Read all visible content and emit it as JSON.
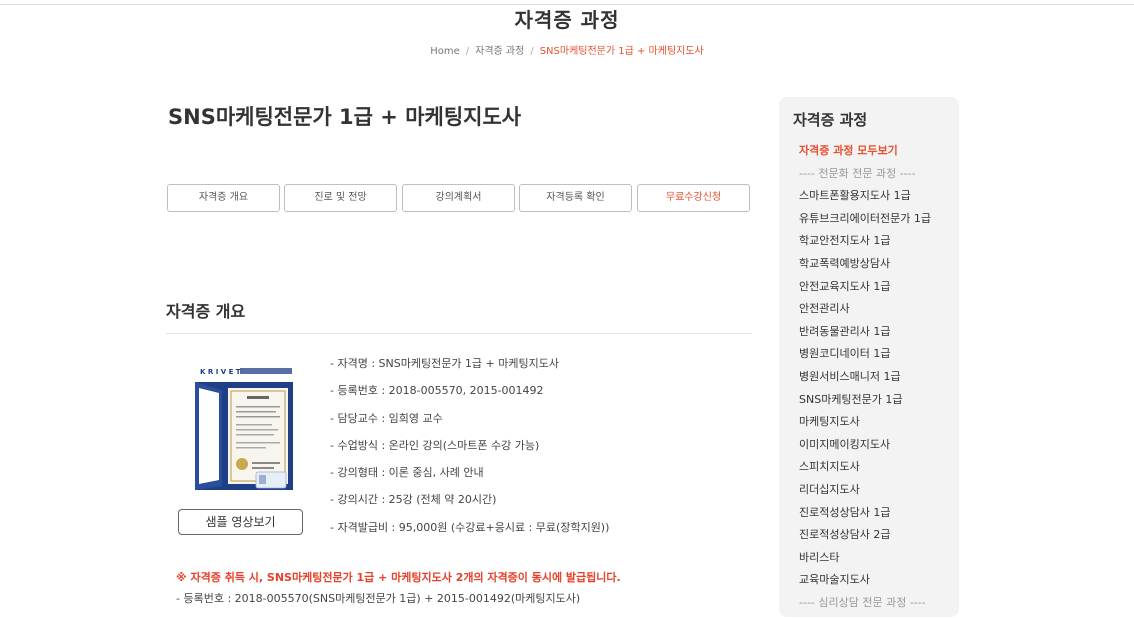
{
  "header": {
    "page_title": "자격증 과정",
    "breadcrumb": {
      "home": "Home",
      "category": "자격증 과정",
      "current": "SNS마케팅전문가 1급 + 마케팅지도사",
      "separator": "/"
    }
  },
  "course": {
    "title": "SNS마케팅전문가 1급 + 마케팅지도사"
  },
  "tabs": [
    {
      "label": "자격증 개요"
    },
    {
      "label": "진로 및 전망"
    },
    {
      "label": "강의계획서"
    },
    {
      "label": "자격등록 확인"
    },
    {
      "label": "무료수강신청"
    }
  ],
  "overview": {
    "section_title": "자격증 개요",
    "image_logo_text": "KRIVET 한국직업능력개발원",
    "sample_button_label": "샘플 영상보기",
    "info": [
      "- 자격명 : SNS마케팅전문가 1급 + 마케팅지도사",
      "- 등록번호 : 2018-005570, 2015-001492",
      "- 담당교수 : 임희영 교수",
      "- 수업방식 : 온라인 강의(스마트폰 수강 가능)",
      "- 강의형태 : 이론 중심, 사례 안내",
      "- 강의시간 : 25강 (전체 약 20시간)",
      "- 자격발급비 : 95,000원 (수강료+응시료 : 무료(장학지원))"
    ],
    "notice": "※ 자격증 취득 시, SNS마케팅전문가 1급 + 마케팅지도사 2개의 자격증이 동시에 발급됩니다.",
    "reg_line": "- 등록번호 : 2018-005570(SNS마케팅전문가 1급) + 2015-001492(마케팅지도사)"
  },
  "sidebar": {
    "title": "자격증 과정",
    "items": [
      {
        "label": "자격증 과정 모두보기",
        "kind": "active"
      },
      {
        "label": "---- 전문화 전문 과정 ----",
        "kind": "group"
      },
      {
        "label": "스마트폰활용지도사 1급",
        "kind": "link"
      },
      {
        "label": "유튜브크리에이터전문가 1급",
        "kind": "link"
      },
      {
        "label": "학교안전지도사 1급",
        "kind": "link"
      },
      {
        "label": "학교폭력예방상담사",
        "kind": "link"
      },
      {
        "label": "안전교육지도사 1급",
        "kind": "link"
      },
      {
        "label": "안전관리사",
        "kind": "link"
      },
      {
        "label": "반려동물관리사 1급",
        "kind": "link"
      },
      {
        "label": "병원코디네이터 1급",
        "kind": "link"
      },
      {
        "label": "병원서비스매니저 1급",
        "kind": "link"
      },
      {
        "label": "SNS마케팅전문가 1급",
        "kind": "link"
      },
      {
        "label": "마케팅지도사",
        "kind": "link"
      },
      {
        "label": "이미지메이킹지도사",
        "kind": "link"
      },
      {
        "label": "스피치지도사",
        "kind": "link"
      },
      {
        "label": "리더십지도사",
        "kind": "link"
      },
      {
        "label": "진로적성상담사 1급",
        "kind": "link"
      },
      {
        "label": "진로적성상담사 2급",
        "kind": "link"
      },
      {
        "label": "바리스타",
        "kind": "link"
      },
      {
        "label": "교육마술지도사",
        "kind": "link"
      },
      {
        "label": "---- 심리상담 전문 과정 ----",
        "kind": "group"
      }
    ]
  },
  "colors": {
    "accent": "#e8502f",
    "notice": "#e8402a",
    "folder_blue": "#1f3f86"
  }
}
